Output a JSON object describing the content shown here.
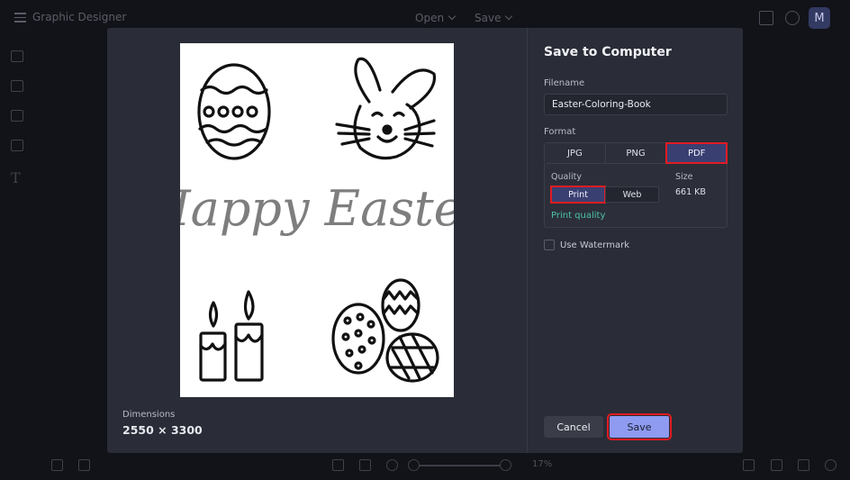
{
  "app": {
    "title": "Graphic Designer",
    "menu_open": "Open",
    "menu_save": "Save",
    "avatar_initial": "M",
    "zoom": "17%"
  },
  "dialog": {
    "title": "Save to Computer",
    "filename_label": "Filename",
    "filename_value": "Easter-Coloring-Book",
    "format_label": "Format",
    "formats": [
      "JPG",
      "PNG",
      "PDF"
    ],
    "selected_format": "PDF",
    "quality_label": "Quality",
    "quality_options": [
      "Print",
      "Web"
    ],
    "selected_quality": "Print",
    "quality_hint": "Print quality",
    "size_label": "Size",
    "size_value": "661 KB",
    "watermark_label": "Use Watermark",
    "watermark_checked": false,
    "cancel_label": "Cancel",
    "save_label": "Save",
    "dimensions_label": "Dimensions",
    "dimensions_value": "2550 × 3300",
    "preview_text": "Happy Easter"
  },
  "colors": {
    "accent": "#8e9bf0",
    "selected": "#3a3f72",
    "highlight": "#e11b22",
    "hint": "#4cc3a5"
  }
}
